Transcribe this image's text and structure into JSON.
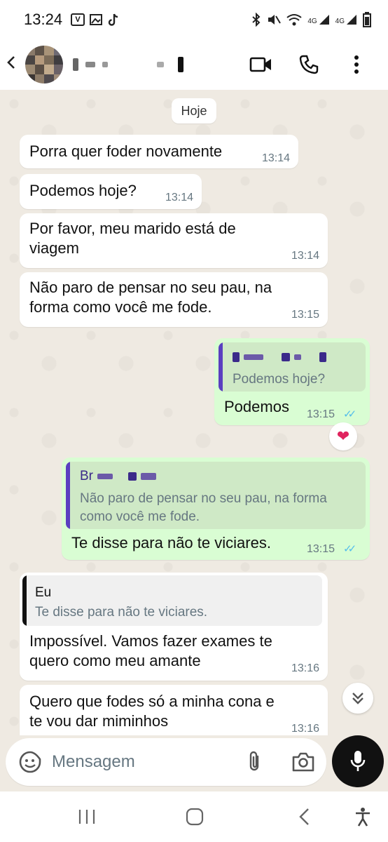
{
  "status_bar": {
    "time": "13:24",
    "left_icons": [
      "v-badge-icon",
      "gallery-icon",
      "tiktok-icon"
    ],
    "right_icons": [
      "bluetooth-icon",
      "mute-icon",
      "wifi-icon",
      "signal-4g-icon",
      "signal-4g-icon",
      "battery-icon"
    ],
    "network_label": "4G"
  },
  "header": {
    "contact_name_redacted": true,
    "icons": [
      "back-arrow-icon",
      "video-call-icon",
      "voice-call-icon",
      "more-vert-icon"
    ]
  },
  "chat": {
    "date_chip": "Hoje",
    "messages": [
      {
        "dir": "in",
        "text_lines": [
          "Porra quer foder novamente"
        ],
        "time": "13:14"
      },
      {
        "dir": "in",
        "text_lines": [
          "Podemos hoje?"
        ],
        "time": "13:14"
      },
      {
        "dir": "in",
        "text_lines": [
          "Por favor, meu marido está de",
          "viagem"
        ],
        "time": "13:14"
      },
      {
        "dir": "in",
        "text_lines": [
          "Não paro de pensar no seu pau, na",
          "forma como você me fode."
        ],
        "time": "13:15"
      },
      {
        "dir": "out",
        "quote_author_redacted": true,
        "quote_text_lines": [
          "Podemos hoje?"
        ],
        "text_lines": [
          "Podemos"
        ],
        "time": "13:15",
        "read": true,
        "reaction": "heart"
      },
      {
        "dir": "out",
        "quote_author_prefix": "Br",
        "quote_text_lines": [
          "Não paro de pensar no seu pau, na forma",
          "como você me fode."
        ],
        "text_lines": [
          "Te disse para não te viciares."
        ],
        "time": "13:15",
        "read": true
      },
      {
        "dir": "in",
        "quote_author": "Eu",
        "quote_text_lines": [
          "Te disse para não te viciares."
        ],
        "text_lines": [
          "Impossível.  Vamos fazer exames te",
          "quero como meu amante"
        ],
        "time": "13:16"
      },
      {
        "dir": "in",
        "text_lines": [
          "Quero que fodes só a minha cona e",
          "te vou dar miminhos"
        ],
        "time": "13:16"
      }
    ]
  },
  "composer": {
    "placeholder": "Mensagem",
    "icons": [
      "emoji-icon",
      "attach-icon",
      "camera-icon",
      "mic-icon"
    ]
  },
  "colors": {
    "chat_bg": "#efeae2",
    "incoming_bubble": "#ffffff",
    "outgoing_bubble": "#d9fdd3",
    "quote_bar_out": "#5a3fc0",
    "quote_bar_in": "#111111",
    "read_ticks": "#53bdeb",
    "time_text": "#667781"
  }
}
